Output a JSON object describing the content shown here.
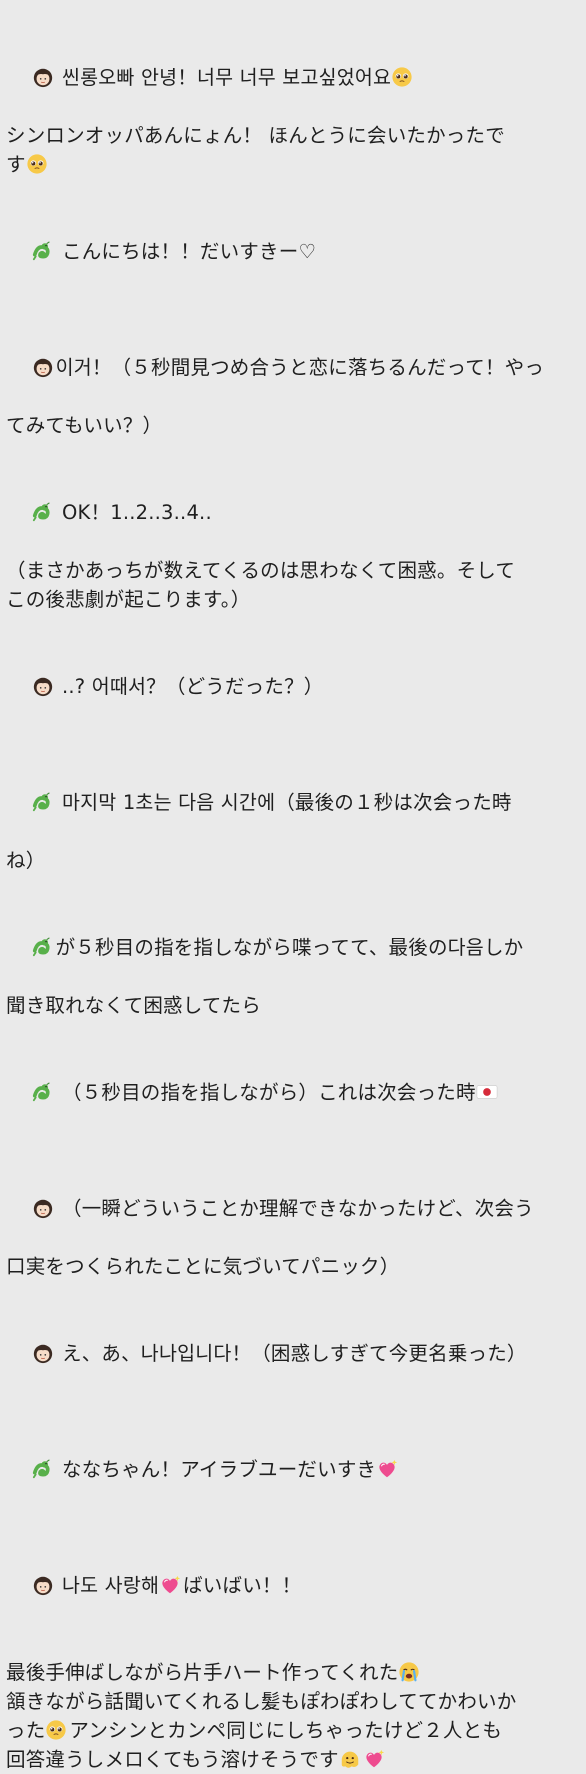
{
  "note": {
    "l1": "씬롱오빠 안녕！너무 너무 보고싶었어요",
    "l2": "シンロンオッパあんにょん！ ほんとうに会いたかったで",
    "l3": "す",
    "l4": " こんにちは！！だいすきー♡",
    "l5": "이거！（５秒間見つめ合うと恋に落ちるんだって！やっ",
    "l6": "てみてもいい？）",
    "l7": " OK！1..2..3..4..",
    "l8": "（まさかあっちが数えてくるのは思わなくて困惑。そして",
    "l9": "この後悲劇が起こります。）",
    "l10": " ..? 어때서？（どうだった？）",
    "l11": " 마지막 1초는 다음 시간에（最後の１秒は次会った時",
    "l12": "ね）",
    "l13": "が５秒目の指を指しながら喋ってて、最後の다음しか",
    "l14": "聞き取れなくて困惑してたら",
    "l15": " （５秒目の指を指しながら）これは次会った時",
    "l16": " （一瞬どういうことか理解できなかったけど、次会う",
    "l17": "口実をつくられたことに気づいてパニック）",
    "l18": " え、あ、나나입니다！（困惑しすぎて今更名乗った）",
    "l19": " ななちゃん！アイラブユーだいすき",
    "l20": " 나도 사랑해",
    "l20b": "ばいばい！！",
    "l21": "最後手伸ばしながら片手ハート作ってくれた",
    "l22": "頷きながら話聞いてくれるし髪もぽわぽわしててかわいか",
    "l23a": "った",
    "l23b": "アンシンとカンペ同じにしちゃったけど２人とも",
    "l24": "回答違うしメロくてもう溶けそうです"
  },
  "icons": {
    "girl": "girl-emoji-icon",
    "dragon": "dragon-emoji-icon",
    "pleading": "pleading-face-emoji-icon",
    "heart": "sparkling-heart-emoji-icon",
    "flag": "japan-flag-emoji-icon",
    "crying": "crying-face-emoji-icon",
    "melting": "melting-face-emoji-icon"
  }
}
